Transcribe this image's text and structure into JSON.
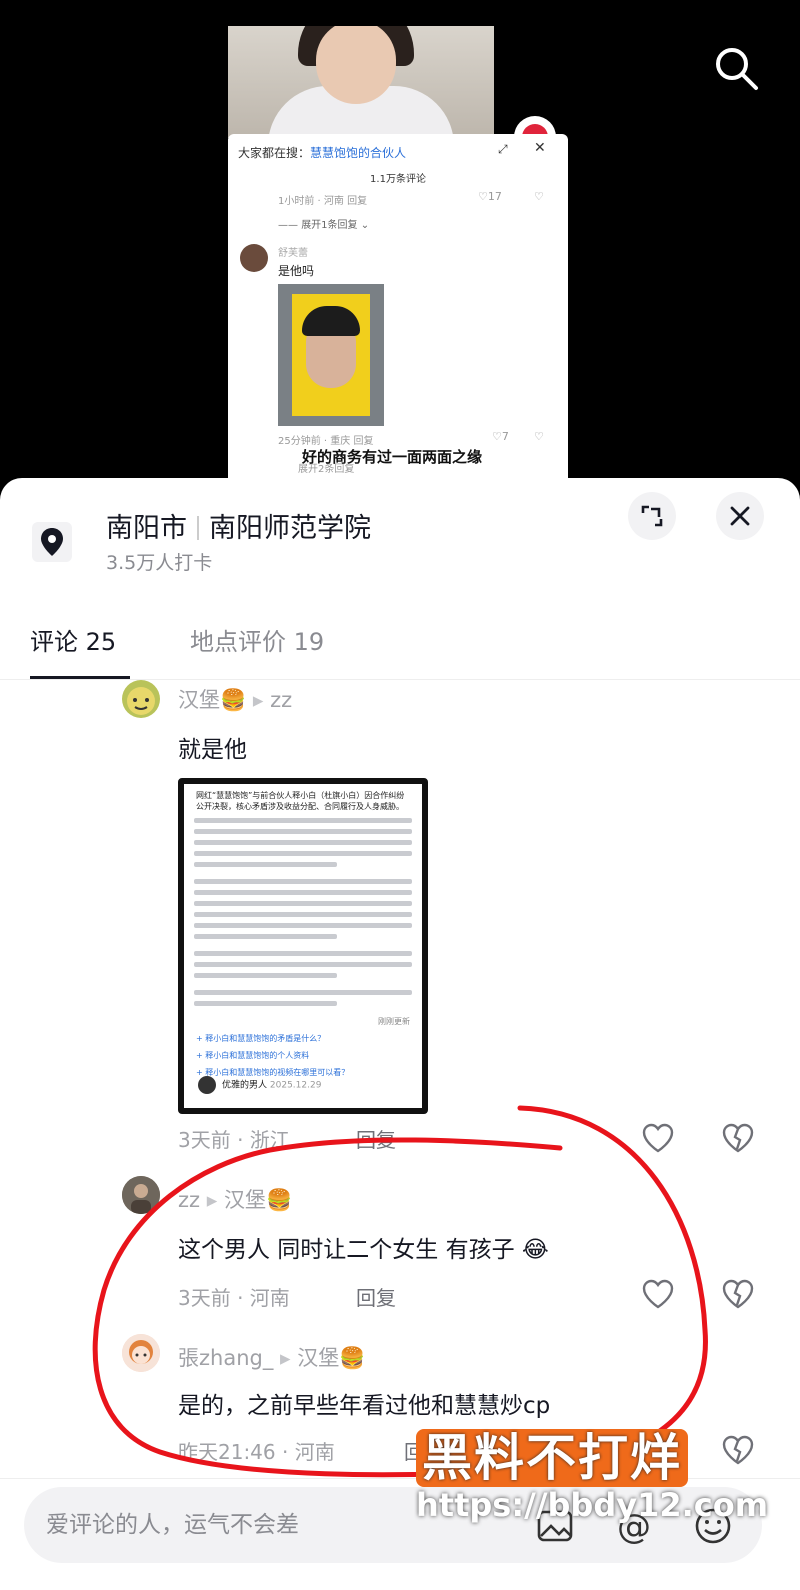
{
  "video": {
    "pip": {
      "search_prefix": "大家都在搜：",
      "search_keyword": "慧慧饱饱的合伙人",
      "comment_count": "1.1万条评论",
      "meta1": "1小时前 · 河南   回复",
      "like1": "17",
      "expand1": "展开1条回复",
      "commenter_name": "舒芙蕾",
      "comment_text": "是他吗",
      "meta2": "25分钟前 · 重庆    回复",
      "like2": "7",
      "caption": "好的商务有过一面两面之缘",
      "expand2": "展开2条回复"
    }
  },
  "location": {
    "city": "南阳市",
    "place": "南阳师范学院",
    "checkins": "3.5万人打卡"
  },
  "tabs": [
    {
      "label": "评论 25",
      "active": true
    },
    {
      "label": "地点评价 19",
      "active": false
    }
  ],
  "comments": [
    {
      "name": "汉堡🍔",
      "reply_to": "zz",
      "text": "就是他",
      "meta": "3天前 · 浙江",
      "reply_label": "回复",
      "screenshot": {
        "title": "网红“慧慧饱饱”与前合伙人释小白（杜旗小白）因合作纠纷公开决裂，核心矛盾涉及收益分配、合同履行及人身威胁。",
        "questions": [
          "释小白和慧慧饱饱的矛盾是什么？",
          "释小白和慧慧饱饱的个人资料",
          "释小白和慧慧饱饱的视频在哪里可以看？"
        ],
        "author": "优雅的男人",
        "date": "2025.12.29",
        "refresh": "刚刚更新"
      }
    },
    {
      "name": "zz",
      "reply_to": "汉堡🍔",
      "text": "这个男人 同时让二个女生 有孩子 😂",
      "meta": "3天前 · 河南",
      "reply_label": "回复"
    },
    {
      "name": "張zhang_",
      "reply_to": "汉堡🍔",
      "text": "是的，之前早些年看过他和慧慧炒cp",
      "meta": "昨天21:46 · 河南",
      "reply_label": "回复"
    }
  ],
  "input": {
    "placeholder": "爱评论的人，运气不会差"
  },
  "watermark": {
    "brand": "黑料不打烊",
    "url": "https://bbdy12.com"
  },
  "colors": {
    "circle": "#e8141b",
    "link": "#2a6fd8"
  }
}
